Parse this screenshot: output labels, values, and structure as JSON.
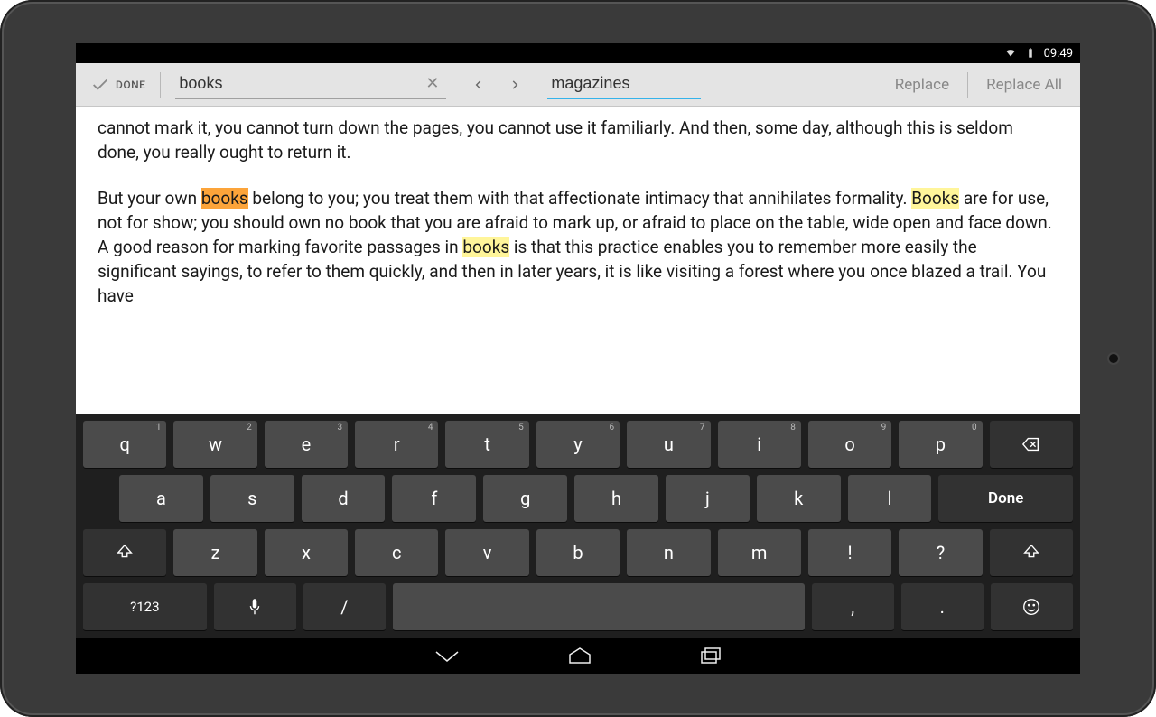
{
  "status": {
    "time": "09:49"
  },
  "toolbar": {
    "done": "DONE",
    "find_value": "books",
    "replace_value": "magazines",
    "replace_btn": "Replace",
    "replace_all_btn": "Replace All"
  },
  "doc": {
    "p1_a": "cannot mark it, you cannot turn down the pages, you cannot use it familiarly. And then, some day, although this is seldom done, you really ought to return it.",
    "p2_a": "But your own ",
    "p2_hl1": "books",
    "p2_b": " belong to you; you treat them with that affectionate intimacy that annihilates formality. ",
    "p2_hl2": "Books",
    "p2_c": " are for use, not for show; you should own no book that you are afraid to mark up, or afraid to place on the table, wide open and face down. A good reason for marking favorite passages in ",
    "p2_hl3": "books",
    "p2_d": " is that this practice enables you to remember more easily the significant sayings, to refer to them quickly, and then in later years, it is like visiting a forest where you once blazed a trail. You have"
  },
  "keyboard": {
    "row1": [
      {
        "l": "q",
        "h": "1"
      },
      {
        "l": "w",
        "h": "2"
      },
      {
        "l": "e",
        "h": "3"
      },
      {
        "l": "r",
        "h": "4"
      },
      {
        "l": "t",
        "h": "5"
      },
      {
        "l": "y",
        "h": "6"
      },
      {
        "l": "u",
        "h": "7"
      },
      {
        "l": "i",
        "h": "8"
      },
      {
        "l": "o",
        "h": "9"
      },
      {
        "l": "p",
        "h": "0"
      }
    ],
    "row2": [
      "a",
      "s",
      "d",
      "f",
      "g",
      "h",
      "j",
      "k",
      "l"
    ],
    "done": "Done",
    "row3": [
      "z",
      "x",
      "c",
      "v",
      "b",
      "n",
      "m",
      "!",
      "?"
    ],
    "sym": "?123",
    "slash": "/",
    "comma": ",",
    "period": "."
  }
}
